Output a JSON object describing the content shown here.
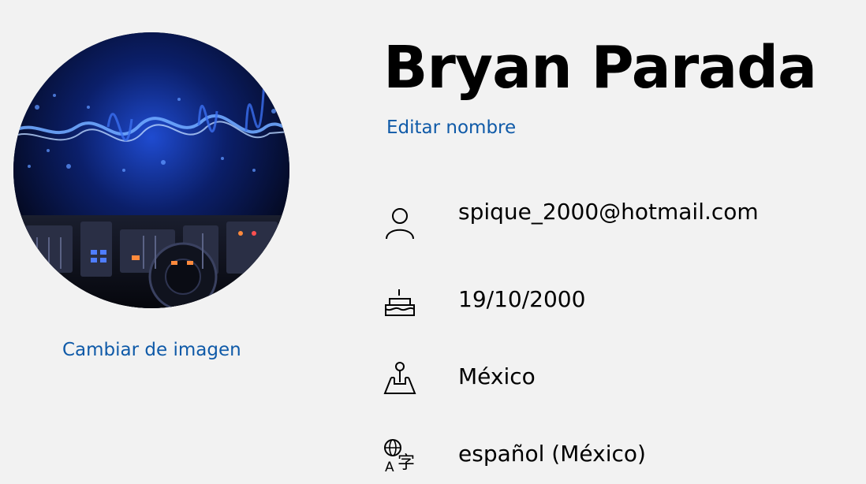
{
  "profile": {
    "name": "Bryan Parada",
    "edit_name_label": "Editar nombre",
    "change_image_label": "Cambiar de imagen",
    "avatar_icon": "dj-mixer-sound-wave-photo"
  },
  "info": {
    "email": "spique_2000@hotmail.com",
    "birthdate": "19/10/2000",
    "country": "México",
    "language": "español (México)"
  },
  "icons": {
    "email": "person-icon",
    "birthdate": "birthday-cake-icon",
    "country": "map-pin-icon",
    "language": "language-icon"
  },
  "colors": {
    "background": "#f2f2f2",
    "link": "#0f5aa8",
    "text": "#000000"
  }
}
